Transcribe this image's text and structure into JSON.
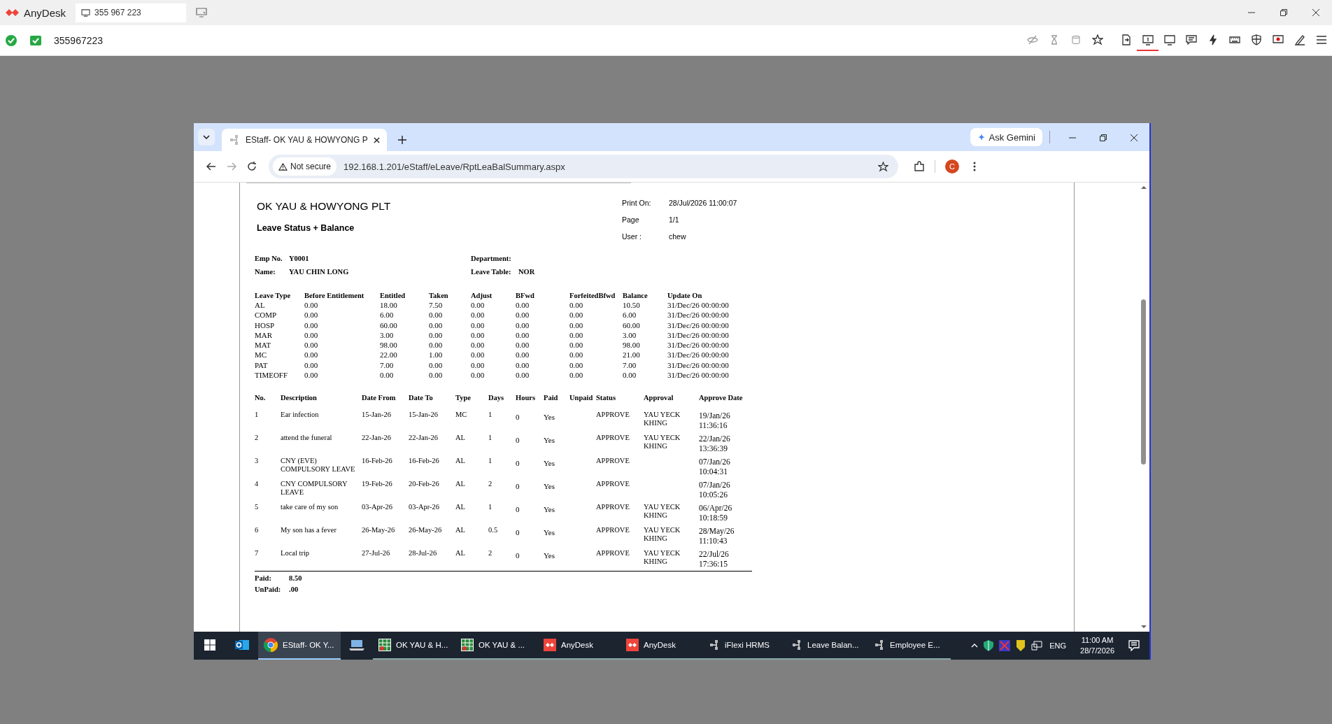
{
  "anydesk": {
    "app_name": "AnyDesk",
    "session_tab": "355 967 223",
    "address": "355967223",
    "tools": [
      {
        "kind": "eye-off",
        "selected": false
      },
      {
        "kind": "hourglass",
        "selected": false
      },
      {
        "kind": "database",
        "selected": false
      },
      {
        "kind": "star",
        "selected": false
      },
      {
        "kind": "file",
        "selected": false
      },
      {
        "kind": "monitor-one",
        "selected": true
      },
      {
        "kind": "monitor",
        "selected": false
      },
      {
        "kind": "chat",
        "selected": false
      },
      {
        "kind": "bolt",
        "selected": false
      },
      {
        "kind": "keyboard",
        "selected": false
      },
      {
        "kind": "shield",
        "selected": false
      },
      {
        "kind": "record",
        "selected": false
      },
      {
        "kind": "pen",
        "selected": false
      },
      {
        "kind": "menu",
        "selected": false
      }
    ]
  },
  "browser": {
    "tab_title": "EStaff- OK YAU & HOWYONG P",
    "ask_button": "Ask Gemini",
    "security": "Not secure",
    "url": "192.168.1.201/eStaff/eLeave/RptLeaBalSummary.aspx",
    "profile_initial": "C"
  },
  "report": {
    "company": "OK YAU & HOWYONG PLT",
    "title": "Leave Status + Balance",
    "meta": [
      {
        "label": "Print On:",
        "value": "28/Jul/2026 11:00:07"
      },
      {
        "label": "Page",
        "value": "1/1"
      },
      {
        "label": "User :",
        "value": "chew"
      }
    ],
    "employee": [
      {
        "label": "Emp No.",
        "value": "Y0001"
      },
      {
        "label": "Name:",
        "value": "YAU CHIN LONG"
      }
    ],
    "assignment": [
      {
        "label": "Department:"
      },
      {
        "label": "Leave Table:",
        "value": "NOR"
      }
    ],
    "balance_columns": [
      "Leave Type",
      "Before Entitlement",
      "Entitled",
      "Taken",
      "Adjust",
      "BFwd",
      "ForfeitedBfwd",
      "Balance",
      "Update On"
    ],
    "balance_rows": [
      [
        "AL",
        "0.00",
        "18.00",
        "7.50",
        "0.00",
        "0.00",
        "0.00",
        "10.50",
        "31/Dec/26 00:00:00"
      ],
      [
        "COMP",
        "0.00",
        "6.00",
        "0.00",
        "0.00",
        "0.00",
        "0.00",
        "6.00",
        "31/Dec/26 00:00:00"
      ],
      [
        "HOSP",
        "0.00",
        "60.00",
        "0.00",
        "0.00",
        "0.00",
        "0.00",
        "60.00",
        "31/Dec/26 00:00:00"
      ],
      [
        "MAR",
        "0.00",
        "3.00",
        "0.00",
        "0.00",
        "0.00",
        "0.00",
        "3.00",
        "31/Dec/26 00:00:00"
      ],
      [
        "MAT",
        "0.00",
        "98.00",
        "0.00",
        "0.00",
        "0.00",
        "0.00",
        "98.00",
        "31/Dec/26 00:00:00"
      ],
      [
        "MC",
        "0.00",
        "22.00",
        "1.00",
        "0.00",
        "0.00",
        "0.00",
        "21.00",
        "31/Dec/26 00:00:00"
      ],
      [
        "PAT",
        "0.00",
        "7.00",
        "0.00",
        "0.00",
        "0.00",
        "0.00",
        "7.00",
        "31/Dec/26 00:00:00"
      ],
      [
        "TIMEOFF",
        "0.00",
        "0.00",
        "0.00",
        "0.00",
        "0.00",
        "0.00",
        "0.00",
        "31/Dec/26 00:00:00"
      ]
    ],
    "leave_columns": [
      "No.",
      "Description",
      "Date From",
      "Date To",
      "Type",
      "Days",
      "Hours",
      "Paid",
      "Unpaid",
      "Status",
      "Approval",
      "Approve Date"
    ],
    "leave_rows": [
      [
        "1",
        "Ear infection",
        "15-Jan-26",
        "15-Jan-26",
        "MC",
        "1",
        "0",
        "Yes",
        "",
        "APPROVE",
        "YAU YECK KHING",
        "19/Jan/26 11:36:16"
      ],
      [
        "2",
        "attend the funeral",
        "22-Jan-26",
        "22-Jan-26",
        "AL",
        "1",
        "0",
        "Yes",
        "",
        "APPROVE",
        "YAU YECK KHING",
        "22/Jan/26 13:36:39"
      ],
      [
        "3",
        "CNY (EVE) COMPULSORY LEAVE",
        "16-Feb-26",
        "16-Feb-26",
        "AL",
        "1",
        "0",
        "Yes",
        "",
        "APPROVE",
        "",
        "07/Jan/26 10:04:31"
      ],
      [
        "4",
        "CNY COMPULSORY LEAVE",
        "19-Feb-26",
        "20-Feb-26",
        "AL",
        "2",
        "0",
        "Yes",
        "",
        "APPROVE",
        "",
        "07/Jan/26 10:05:26"
      ],
      [
        "5",
        "take care of my son",
        "03-Apr-26",
        "03-Apr-26",
        "AL",
        "1",
        "0",
        "Yes",
        "",
        "APPROVE",
        "YAU YECK KHING",
        "06/Apr/26 10:18:59"
      ],
      [
        "6",
        "My son has a fever",
        "26-May-26",
        "26-May-26",
        "AL",
        "0.5",
        "0",
        "Yes",
        "",
        "APPROVE",
        "YAU YECK KHING",
        "28/May/26 11:10:43"
      ],
      [
        "7",
        "Local trip",
        "27-Jul-26",
        "28-Jul-26",
        "AL",
        "2",
        "0",
        "Yes",
        "",
        "APPROVE",
        "YAU YECK KHING",
        "22/Jul/26 17:36:15"
      ]
    ],
    "totals": [
      {
        "label": "Paid:",
        "value": "8.50"
      },
      {
        "label": "UnPaid:",
        "value": ".00"
      }
    ]
  },
  "taskbar": {
    "items": [
      {
        "kind": "start",
        "selected": false
      },
      {
        "kind": "outlook",
        "selected": false
      },
      {
        "kind": "chrome",
        "label": "EStaff- OK Y...",
        "selected": true
      },
      {
        "kind": "computer",
        "selected": false
      },
      {
        "kind": "sheet",
        "label": "OK YAU & H...",
        "selected": false
      },
      {
        "kind": "sheet",
        "label": "OK YAU & ...",
        "selected": false
      },
      {
        "kind": "anydesk",
        "label": "AnyDesk",
        "selected": false
      },
      {
        "kind": "anydesk",
        "label": "AnyDesk",
        "selected": false
      },
      {
        "kind": "hrms",
        "label": "iFlexi HRMS",
        "selected": false
      },
      {
        "kind": "hrms",
        "label": "Leave Balan...",
        "selected": false
      },
      {
        "kind": "hrms",
        "label": "Employee E...",
        "selected": false
      }
    ],
    "language": "ENG",
    "time": "11:00 AM",
    "date": "28/7/2026"
  }
}
